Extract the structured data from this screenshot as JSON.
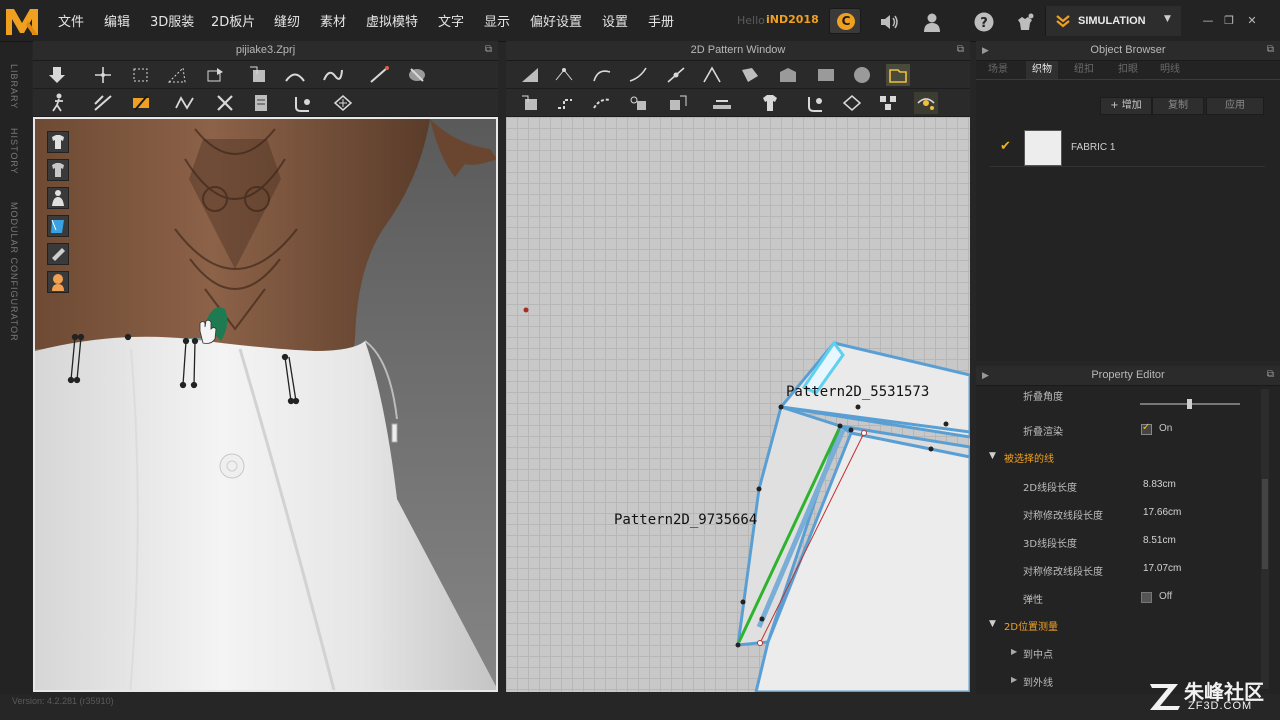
{
  "menu": {
    "items": [
      "文件",
      "编辑",
      "3D服装",
      "2D板片",
      "缝纫",
      "素材",
      "虚拟模特",
      "文字",
      "显示",
      "偏好设置",
      "设置",
      "手册"
    ],
    "hello": "Hello",
    "user": "iND2018",
    "mode_label": "SIMULATION",
    "window_buttons": [
      "—",
      "❐",
      "✕"
    ]
  },
  "left_rail": {
    "labels": [
      "LIBRARY",
      "HISTORY",
      "MODULAR CONFIGURATOR"
    ]
  },
  "viewport3d": {
    "title": "pijiake3.Zprj"
  },
  "pattern_window": {
    "title": "2D Pattern Window",
    "labels": [
      "Pattern2D_5531573",
      "Pattern2D_9735664"
    ]
  },
  "object_browser": {
    "title": "Object Browser",
    "tabs": [
      "场景",
      "织物",
      "纽扣",
      "扣眼",
      "明线"
    ],
    "active_tab": "织物",
    "buttons": [
      "+ 增加",
      "复制",
      "应用"
    ],
    "fabric": {
      "name": "FABRIC 1",
      "selected": true
    }
  },
  "property_editor": {
    "title": "Property Editor",
    "fold_angle_label": "折叠角度",
    "fold_render_label": "折叠渲染",
    "fold_render_value": "On",
    "section_selected_line": "被选择的线",
    "rows": [
      {
        "label": "2D线段长度",
        "value": "8.83cm"
      },
      {
        "label": "对称修改线段长度",
        "value": "17.66cm"
      },
      {
        "label": "3D线段长度",
        "value": "8.51cm"
      },
      {
        "label": "对称修改线段长度",
        "value": "17.07cm"
      }
    ],
    "elastic_label": "弹性",
    "elastic_value": "Off",
    "section_2d_measure": "2D位置测量",
    "sub_items": [
      "到中点",
      "到外线"
    ]
  },
  "status": {
    "version": "Version: 4.2.281 (r35910)"
  },
  "watermark": {
    "brand": "朱峰社区",
    "url": "ZF3D.COM"
  },
  "colors": {
    "accent": "#f0a020",
    "pattern_outline": "#5a9fd4",
    "seam_green": "#2db32d",
    "background": "#262626"
  },
  "icons": [
    "app-logo-icon",
    "c-badge-icon",
    "speaker-icon",
    "user-icon",
    "help-icon",
    "avatar-settings-icon",
    "simulation-icon",
    "check-icon",
    "expand-triangle-icon"
  ]
}
